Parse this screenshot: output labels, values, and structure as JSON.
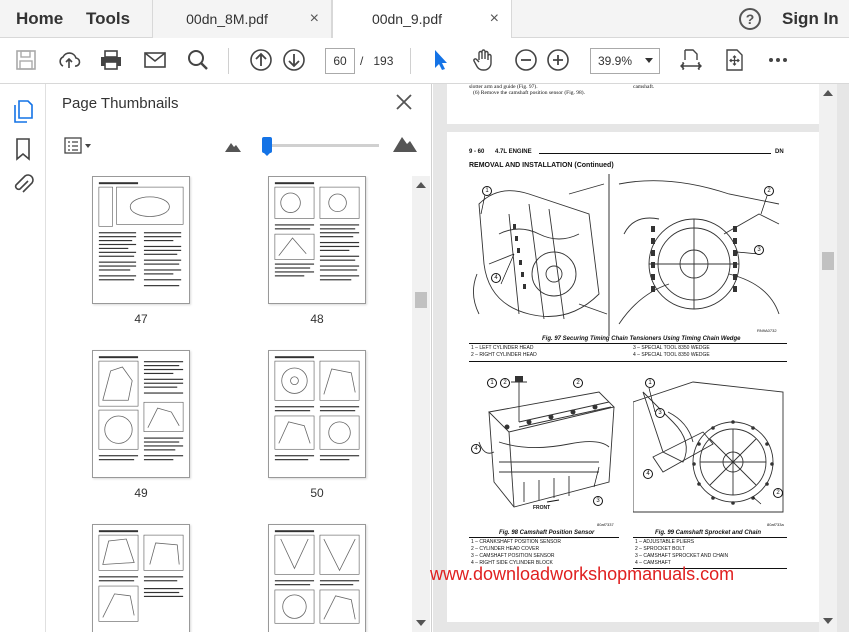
{
  "topnav": {
    "home": "Home",
    "tools": "Tools"
  },
  "tabs": [
    {
      "label": "00dn_8M.pdf",
      "close": "×"
    },
    {
      "label": "00dn_9.pdf",
      "close": "×"
    }
  ],
  "header": {
    "help": "?",
    "signin": "Sign In"
  },
  "toolbar": {
    "icons": [
      "save-icon",
      "upload-icon",
      "print-icon",
      "email-icon",
      "search-icon",
      "prev-page-icon",
      "next-page-icon",
      "select-cursor-icon",
      "hand-icon",
      "zoom-out-icon",
      "zoom-in-icon",
      "fit-width-icon",
      "fit-page-icon",
      "more-icon"
    ],
    "page_current": "60",
    "page_sep": "/",
    "page_total": "193",
    "zoom": "39.9%"
  },
  "rail": {
    "icons": [
      "page-thumbnails-icon",
      "bookmarks-icon",
      "attachments-icon"
    ]
  },
  "panel": {
    "title": "Page Thumbnails",
    "close": "×",
    "thumbnails": [
      {
        "num": "47"
      },
      {
        "num": "48"
      },
      {
        "num": "49"
      },
      {
        "num": "50"
      },
      {
        "num": ""
      },
      {
        "num": ""
      }
    ]
  },
  "document": {
    "prev_page_text_1": "slotter arm and guide (Fig. 97).",
    "prev_page_text_2": "(6) Remove the camshaft position sensor (Fig. 98).",
    "prev_page_text_3": "camshaft.",
    "page_header_left": "9 - 60",
    "page_header_mid": "4.7L ENGINE",
    "page_header_right": "DN",
    "section_title": "REMOVAL AND INSTALLATION (Continued)",
    "fig97": {
      "caption": "Fig. 97 Securing Timing Chain Tensioners Using Timing Chain Wedge",
      "legend": [
        "1 – LEFT CYLINDER HEAD",
        "2 – RIGHT CYLINDER HEAD",
        "3 – SPECIAL TOOL 8350 WEDGE",
        "4 – SPECIAL TOOL 8350 WEDGE"
      ],
      "code": "RN9A0732"
    },
    "fig98": {
      "caption": "Fig. 98 Camshaft Position Sensor",
      "legend": [
        "1 – CRANKSHAFT POSITION SENSOR",
        "2 – CYLINDER HEAD COVER",
        "3 – CAMSHAFT POSITION SENSOR",
        "4 – RIGHT SIDE CYLINDER BLOCK"
      ],
      "front": "FRONT",
      "code": "80af7337"
    },
    "fig99": {
      "caption": "Fig. 99 Camshaft Sprocket and Chain",
      "legend": [
        "1 – ADJUSTABLE PLIERS",
        "2 – SPROCKET BOLT",
        "3 – CAMSHAFT SPROCKET AND CHAIN",
        "4 – CAMSHAFT"
      ],
      "code": "80af733a"
    },
    "watermark": "www.downloadworkshopmanuals.com"
  }
}
